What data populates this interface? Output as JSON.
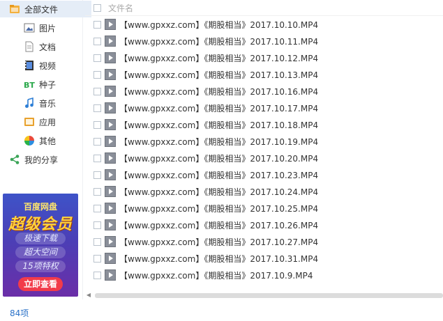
{
  "sidebar": {
    "items": [
      {
        "label": "全部文件",
        "icon": "folder-icon"
      },
      {
        "label": "图片",
        "icon": "image-icon"
      },
      {
        "label": "文档",
        "icon": "document-icon"
      },
      {
        "label": "视频",
        "icon": "video-icon"
      },
      {
        "label": "种子",
        "icon": "bt-icon"
      },
      {
        "label": "音乐",
        "icon": "music-icon"
      },
      {
        "label": "应用",
        "icon": "app-icon"
      },
      {
        "label": "其他",
        "icon": "other-icon"
      },
      {
        "label": "我的分享",
        "icon": "share-icon"
      }
    ]
  },
  "ad": {
    "brand": "百度网盘",
    "headline": "超级会员",
    "perks": [
      "极速下载",
      "超大空间",
      "15项特权"
    ],
    "cta": "立即查看"
  },
  "header": {
    "filename_label": "文件名"
  },
  "files": [
    "【www.gpxxz.com】《期股相当》2017.10.10.MP4",
    "【www.gpxxz.com】《期股相当》2017.10.11.MP4",
    "【www.gpxxz.com】《期股相当》2017.10.12.MP4",
    "【www.gpxxz.com】《期股相当》2017.10.13.MP4",
    "【www.gpxxz.com】《期股相当》2017.10.16.MP4",
    "【www.gpxxz.com】《期股相当》2017.10.17.MP4",
    "【www.gpxxz.com】《期股相当》2017.10.18.MP4",
    "【www.gpxxz.com】《期股相当》2017.10.19.MP4",
    "【www.gpxxz.com】《期股相当》2017.10.20.MP4",
    "【www.gpxxz.com】《期股相当》2017.10.23.MP4",
    "【www.gpxxz.com】《期股相当》2017.10.24.MP4",
    "【www.gpxxz.com】《期股相当》2017.10.25.MP4",
    "【www.gpxxz.com】《期股相当》2017.10.26.MP4",
    "【www.gpxxz.com】《期股相当》2017.10.27.MP4",
    "【www.gpxxz.com】《期股相当》2017.10.31.MP4",
    "【www.gpxxz.com】《期股相当》2017.10.9.MP4"
  ],
  "status": {
    "count": "84项"
  },
  "colors": {
    "accent": "#2b72c8",
    "active_bg": "#e5edf7",
    "cta": "#f23b4a"
  }
}
